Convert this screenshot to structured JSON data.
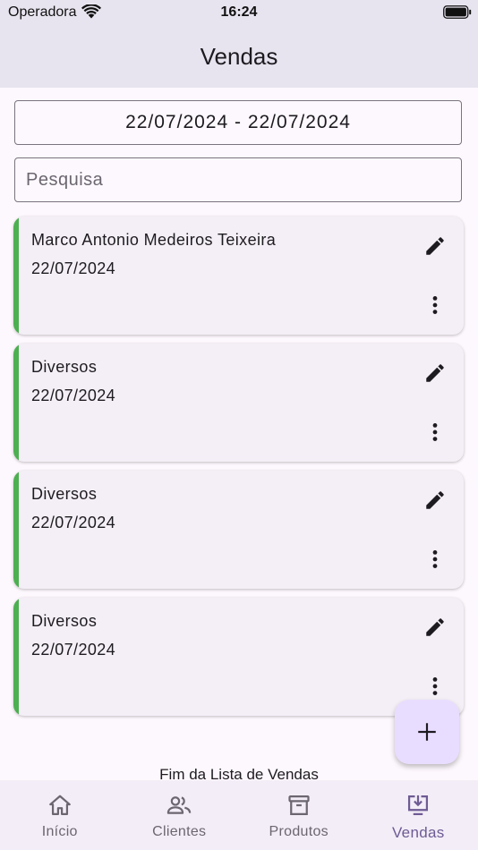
{
  "status_bar": {
    "carrier": "Operadora",
    "time": "16:24"
  },
  "app_bar": {
    "title": "Vendas"
  },
  "filters": {
    "date_range": "22/07/2024 - 22/07/2024",
    "search_placeholder": "Pesquisa",
    "search_value": ""
  },
  "sales": [
    {
      "customer": "Marco Antonio Medeiros Teixeira",
      "date": "22/07/2024"
    },
    {
      "customer": "Diversos",
      "date": "22/07/2024"
    },
    {
      "customer": "Diversos",
      "date": "22/07/2024"
    },
    {
      "customer": "Diversos",
      "date": "22/07/2024"
    }
  ],
  "footer_text": "Fim da Lista de Vendas",
  "nav": {
    "items": [
      {
        "label": "Início",
        "icon": "home-icon"
      },
      {
        "label": "Clientes",
        "icon": "people-icon"
      },
      {
        "label": "Produtos",
        "icon": "archive-icon"
      },
      {
        "label": "Vendas",
        "icon": "download-screen-icon"
      }
    ],
    "active_index": 3
  },
  "colors": {
    "accent_stripe": "#4caf50",
    "active_nav": "#6d5b94",
    "fab_background": "#e9ddff",
    "app_bar": "#e8e4ef"
  }
}
